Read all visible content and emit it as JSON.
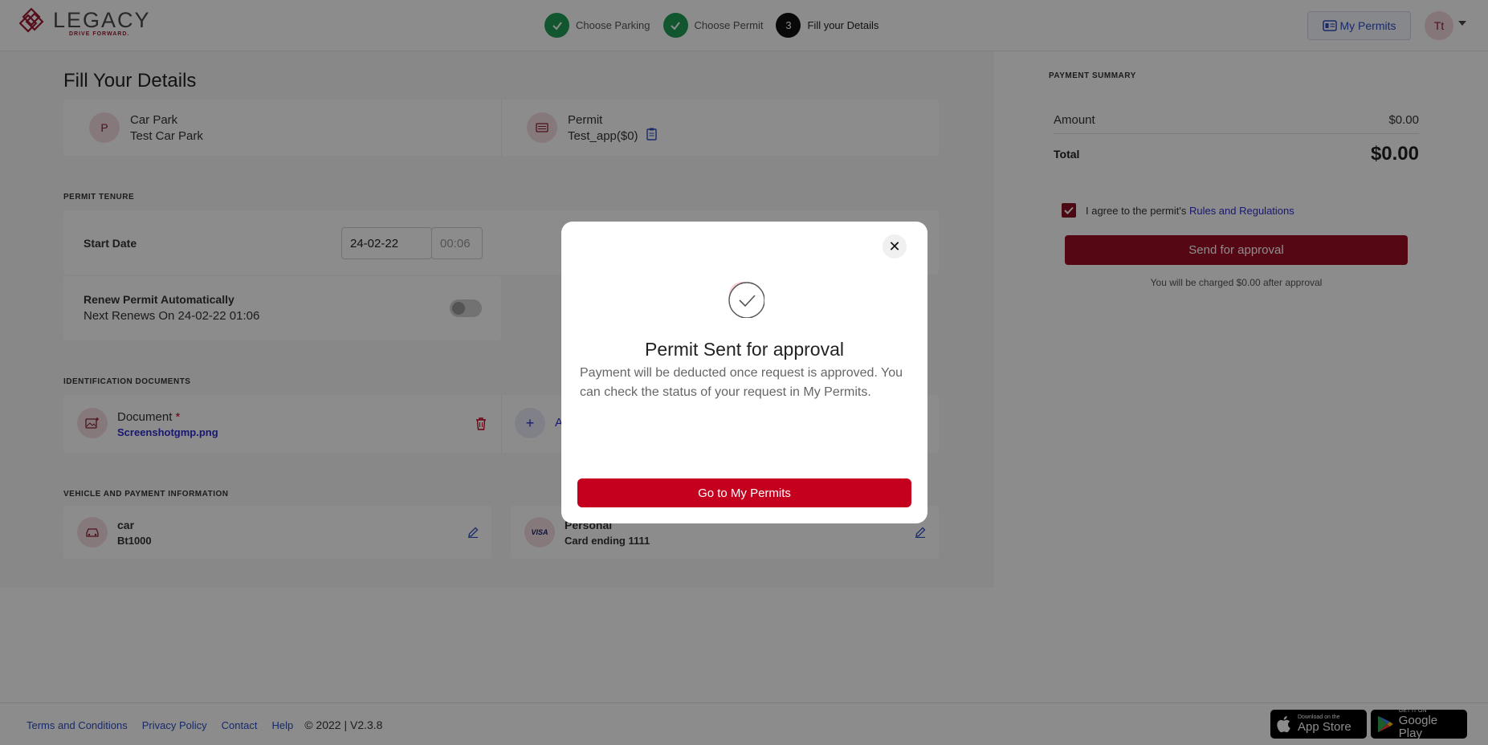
{
  "header": {
    "logo_word": "LEGACY",
    "logo_tagline": "DRIVE FORWARD.",
    "steps": [
      {
        "label": "Choose Parking",
        "state": "done"
      },
      {
        "label": "Choose Permit",
        "state": "done"
      },
      {
        "label": "Fill your Details",
        "state": "active",
        "number": "3"
      }
    ],
    "my_permits_label": "My Permits",
    "avatar_initials": "Tt"
  },
  "main": {
    "page_title": "Fill Your Details",
    "car_park": {
      "label": "Car Park",
      "value": "Test Car Park",
      "icon": "P"
    },
    "permit": {
      "label": "Permit",
      "value": "Test_app($0)"
    },
    "tenure": {
      "section_title": "PERMIT TENURE",
      "start_date_label": "Start Date",
      "start_date": "24-02-22",
      "start_time": "00:06",
      "renew_label": "Renew Permit Automatically",
      "renew_next": "Next Renews On 24-02-22 01:06",
      "renew_enabled": false
    },
    "documents": {
      "section_title": "IDENTIFICATION DOCUMENTS",
      "doc_label": "Document",
      "required_mark": "*",
      "file_name": "Screenshotgmp.png",
      "add_label": "A"
    },
    "vehicle_payment": {
      "section_title": "VEHICLE AND PAYMENT INFORMATION",
      "vehicle_name": "car",
      "vehicle_plate": "Bt1000",
      "payment_name": "Personal",
      "payment_card": "Card ending 1111",
      "card_brand": "VISA"
    }
  },
  "summary": {
    "title": "PAYMENT SUMMARY",
    "amount_label": "Amount",
    "amount_value": "$0.00",
    "total_label": "Total",
    "total_value": "$0.00",
    "agree_text": "I agree to the permit's",
    "agree_link": "Rules and Regulations",
    "agree_checked": true,
    "send_label": "Send for approval",
    "charged_text": "You will be charged  $0.00  after approval"
  },
  "footer": {
    "links": [
      "Terms and Conditions",
      "Privacy Policy",
      "Contact",
      "Help"
    ],
    "copyright": "© 2022 | V2.3.8",
    "appstore_small": "Download on the",
    "appstore_big": "App Store",
    "googleplay_small": "GET IT ON",
    "googleplay_big": "Google Play"
  },
  "modal": {
    "title": "Permit Sent for approval",
    "message": "Payment will be deducted once request is approved. You can check the status of your request in My Permits.",
    "button_label": "Go to My Permits",
    "close_symbol": "✕"
  },
  "colors": {
    "brand": "#9b0f25",
    "modal_button": "#c5001f",
    "step_done": "#1f9d55",
    "link": "#2c2ccf"
  }
}
